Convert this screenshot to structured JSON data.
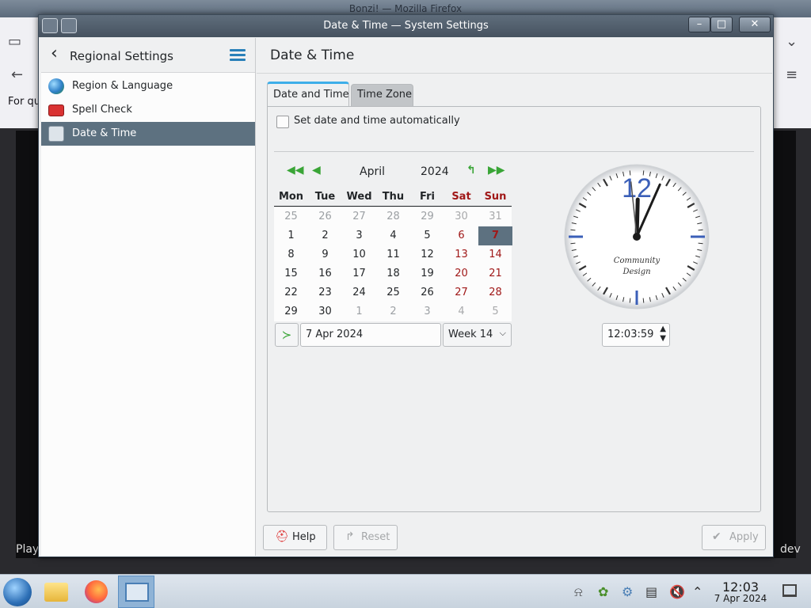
{
  "background": {
    "window_title": "Bonzi! — Mozilla Firefox",
    "partial_text": "For qu",
    "bottom_left": "Play",
    "bottom_right": "dev"
  },
  "window": {
    "title": "Date & Time — System Settings"
  },
  "sidebar": {
    "title": "Regional Settings",
    "items": [
      {
        "label": "Region & Language",
        "icon": "globe-icon"
      },
      {
        "label": "Spell Check",
        "icon": "spellcheck-icon"
      },
      {
        "label": "Date & Time",
        "icon": "date-time-icon",
        "active": true
      }
    ]
  },
  "page": {
    "title": "Date & Time",
    "tabs": [
      {
        "label": "Date and Time",
        "active": true
      },
      {
        "label": "Time Zone",
        "active": false
      }
    ],
    "auto_label": "Set date and time automatically",
    "auto_checked": false
  },
  "calendar": {
    "month": "April",
    "year": "2024",
    "weekdays": [
      "Mon",
      "Tue",
      "Wed",
      "Thu",
      "Fri",
      "Sat",
      "Sun"
    ],
    "weeks": [
      [
        "25",
        "26",
        "27",
        "28",
        "29",
        "30",
        "31"
      ],
      [
        "1",
        "2",
        "3",
        "4",
        "5",
        "6",
        "7"
      ],
      [
        "8",
        "9",
        "10",
        "11",
        "12",
        "13",
        "14"
      ],
      [
        "15",
        "16",
        "17",
        "18",
        "19",
        "20",
        "21"
      ],
      [
        "22",
        "23",
        "24",
        "25",
        "26",
        "27",
        "28"
      ],
      [
        "29",
        "30",
        "1",
        "2",
        "3",
        "4",
        "5"
      ]
    ],
    "selected_day": "7",
    "date_value": "7 Apr 2024",
    "week_value": "Week 14"
  },
  "clock": {
    "brand_line1": "Community",
    "brand_line2": "Design",
    "twelve": "12",
    "hour": 12,
    "minute": 3,
    "second": 59,
    "time_value": "12:03:59"
  },
  "buttons": {
    "help": "Help",
    "reset": "Reset",
    "apply": "Apply"
  },
  "taskbar": {
    "time": "12:03",
    "date": "7 Apr 2024"
  },
  "colors": {
    "accent": "#3daee9",
    "selection": "#5d7180",
    "weekend": "#a01818",
    "clock_hand_blue": "#3b5fb8"
  }
}
